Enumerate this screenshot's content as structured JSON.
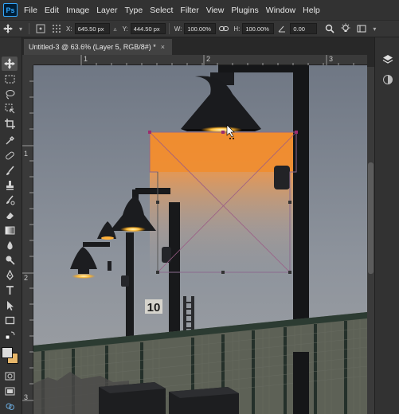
{
  "app": {
    "logo_text": "Ps"
  },
  "menu": [
    "File",
    "Edit",
    "Image",
    "Layer",
    "Type",
    "Select",
    "Filter",
    "View",
    "Plugins",
    "Window",
    "Help"
  ],
  "options": {
    "x_label": "X:",
    "x_value": "645.50 px",
    "y_label": "Y:",
    "y_value": "444.50 px",
    "w_label": "W:",
    "w_value": "100.00%",
    "h_label": "H:",
    "h_value": "100.00%",
    "angle_value": "0.00"
  },
  "tab": {
    "title": "Untitled-3 @ 63.6% (Layer 5, RGB/8#) *",
    "close": "×"
  },
  "ruler": {
    "h_ticks": [
      "1",
      "2",
      "3"
    ],
    "v_ticks": [
      "1",
      "2",
      "3"
    ]
  },
  "canvas": {
    "sign_number": "10"
  },
  "colors": {
    "accent": "#31a8ff",
    "foreground_swatch": "#dcdcdc",
    "background_swatch": "#e8b76a"
  }
}
